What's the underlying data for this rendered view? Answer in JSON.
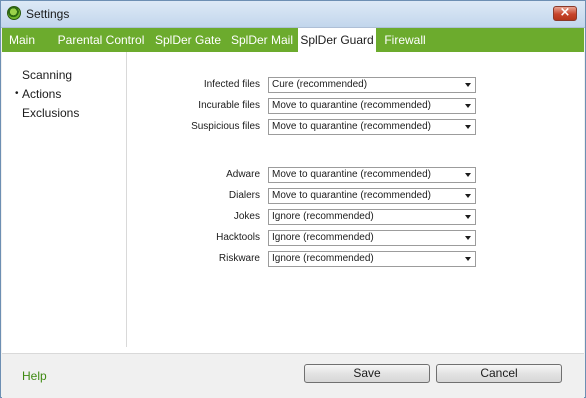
{
  "window": {
    "title": "Settings"
  },
  "tabs": [
    {
      "label": "Main",
      "active": false
    },
    {
      "label": "Parental Control",
      "active": false
    },
    {
      "label": "SplDer Gate",
      "active": false
    },
    {
      "label": "SplDer Mail",
      "active": false
    },
    {
      "label": "SplDer Guard",
      "active": true
    },
    {
      "label": "Firewall",
      "active": false
    }
  ],
  "sidebar": {
    "items": [
      {
        "label": "Scanning",
        "selected": false
      },
      {
        "label": "Actions",
        "selected": true
      },
      {
        "label": "Exclusions",
        "selected": false
      }
    ],
    "selected_marker": "•"
  },
  "actions": {
    "files": [
      {
        "label": "Infected files",
        "value": "Cure (recommended)"
      },
      {
        "label": "Incurable files",
        "value": "Move to quarantine (recommended)"
      },
      {
        "label": "Suspicious files",
        "value": "Move to quarantine (recommended)"
      }
    ],
    "threats": [
      {
        "label": "Adware",
        "value": "Move to quarantine (recommended)"
      },
      {
        "label": "Dialers",
        "value": "Move to quarantine (recommended)"
      },
      {
        "label": "Jokes",
        "value": "Ignore (recommended)"
      },
      {
        "label": "Hacktools",
        "value": "Ignore (recommended)"
      },
      {
        "label": "Riskware",
        "value": "Ignore (recommended)"
      }
    ]
  },
  "footer": {
    "help_label": "Help",
    "save_label": "Save",
    "cancel_label": "Cancel"
  },
  "icons": {
    "app": "spider-app-icon",
    "close": "close-icon",
    "dropdown": "chevron-down-icon"
  },
  "colors": {
    "tab_bar": "#6cab2d",
    "help_link": "#3f8a12",
    "close_button": "#c7432a"
  }
}
